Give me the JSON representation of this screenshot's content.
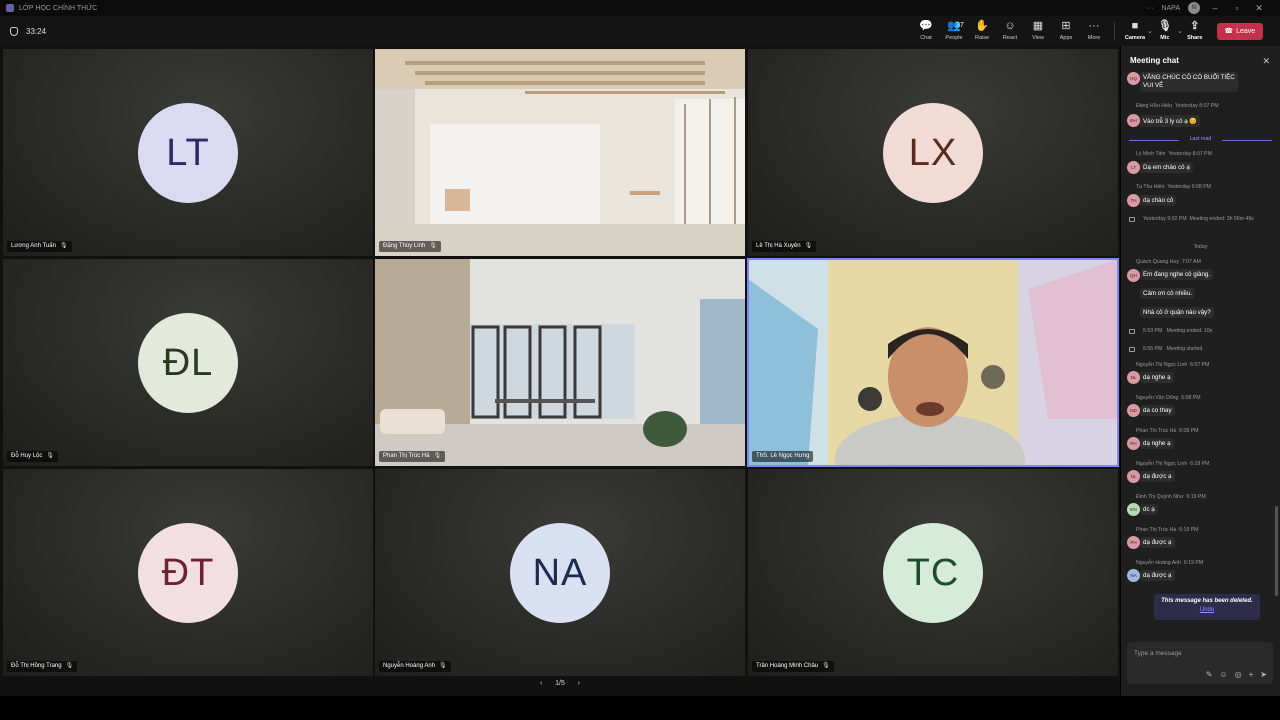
{
  "window": {
    "title": "LỚP HỌC CHÍNH THỨC",
    "user_short": "NAPA"
  },
  "meeting": {
    "timer": "33:24"
  },
  "toolbar": {
    "chat": "Chat",
    "people": "People",
    "people_count": "37",
    "raise": "Raise",
    "react": "React",
    "view": "View",
    "apps": "Apps",
    "more": "More",
    "camera": "Camera",
    "mic": "Mic",
    "share": "Share",
    "leave": "Leave"
  },
  "tiles": [
    {
      "initials": "LT",
      "name": "Lương Anh Tuấn",
      "avatar_bg": "#dcdaf0",
      "avatar_fg": "#2b2b66"
    },
    {
      "name": "Đặng Thùy Linh",
      "video": "room-1"
    },
    {
      "initials": "LX",
      "name": "Lê Thị Hà Xuyên",
      "avatar_bg": "#f0dcd4",
      "avatar_fg": "#5a2a1e"
    },
    {
      "initials": "ĐL",
      "name": "Đỗ Huy Lộc",
      "avatar_bg": "#e3eadc",
      "avatar_fg": "#2a3a22"
    },
    {
      "name": "Phan Thị Trúc Hà",
      "video": "room-2"
    },
    {
      "name": "ThS. Lê Ngọc Hưng",
      "video": "speaker"
    },
    {
      "initials": "ĐT",
      "name": "Đỗ Thị Hồng Trang",
      "avatar_bg": "#f2dfe2",
      "avatar_fg": "#6b2233"
    },
    {
      "initials": "NA",
      "name": "Nguyễn Hoàng Anh",
      "avatar_bg": "#d8e0f2",
      "avatar_fg": "#1c2b4d"
    },
    {
      "initials": "TC",
      "name": "Trần Hoàng Minh Châu",
      "avatar_bg": "#d6ebda",
      "avatar_fg": "#1f4d2a"
    }
  ],
  "pager": {
    "page": "1/5",
    "prev": "‹",
    "next": "›"
  },
  "chat": {
    "title": "Meeting chat",
    "top_message_1": "VẪNG CHÚC CÔ CÓ BUỔI TIỆC",
    "top_message_2": "VUI VẺ",
    "messages": [
      {
        "sender": "Đặng Hữu Hiếu",
        "time": "Yesterday 8:07 PM",
        "text": "Vào trễ 3 ly cô ạ 😊",
        "av": "ĐH"
      },
      {
        "sender": "Lý Minh Tiến",
        "time": "Yesterday 8:07 PM",
        "text": "Dạ em chào cô ạ",
        "av": "LT"
      },
      {
        "sender": "Tạ Thu Hiền",
        "time": "Yesterday 9:08 PM",
        "text": "dạ chào cô",
        "av": "TH"
      },
      {
        "sender": "Quách Quang Huy",
        "time": "7:07 AM",
        "text": "Em đang nghe cô giảng.",
        "av": "QH"
      },
      {
        "text": "Cảm ơn cô nhiều."
      },
      {
        "text": "Nhà cô ở quận nào vậy?"
      },
      {
        "sender": "Nguyễn Thị Ngọc Linh",
        "time": "6:07 PM",
        "text": "dạ nghe ạ",
        "av": "NL"
      },
      {
        "sender": "Nguyễn Văn Dũng",
        "time": "6:08 PM",
        "text": "da co thay",
        "av": "ND"
      },
      {
        "sender": "Phan Thị Trúc Hà",
        "time": "6:08 PM",
        "text": "dạ nghe ạ",
        "av": "PH"
      },
      {
        "sender": "Nguyễn Thị Ngọc Linh",
        "time": "6:18 PM",
        "text": "dạ được ạ",
        "av": "NL"
      },
      {
        "sender": "Đinh Thị Quỳnh Như",
        "time": "6:19 PM",
        "text": "dc ạ",
        "av": "ĐN"
      },
      {
        "sender": "Phan Thị Trúc Hà",
        "time": "6:19 PM",
        "text": "dạ được ạ",
        "av": "PH"
      },
      {
        "sender": "Nguyễn Hoàng Anh",
        "time": "6:19 PM",
        "text": "dạ được ạ",
        "av": "NA"
      }
    ],
    "last_read": "Last read",
    "sys_yesterday": "Yesterday 9:02 PM",
    "sys_yesterday_text": "Meeting ended: 3h 56m 49s",
    "today": "Today",
    "sys_1_time": "5:53 PM",
    "sys_1_text": "Meeting ended: 10s",
    "sys_2_time": "5:55 PM",
    "sys_2_text": "Meeting started",
    "deleted": "This message has been deleted.",
    "undo": "Undo",
    "composer_placeholder": "Type a message"
  }
}
